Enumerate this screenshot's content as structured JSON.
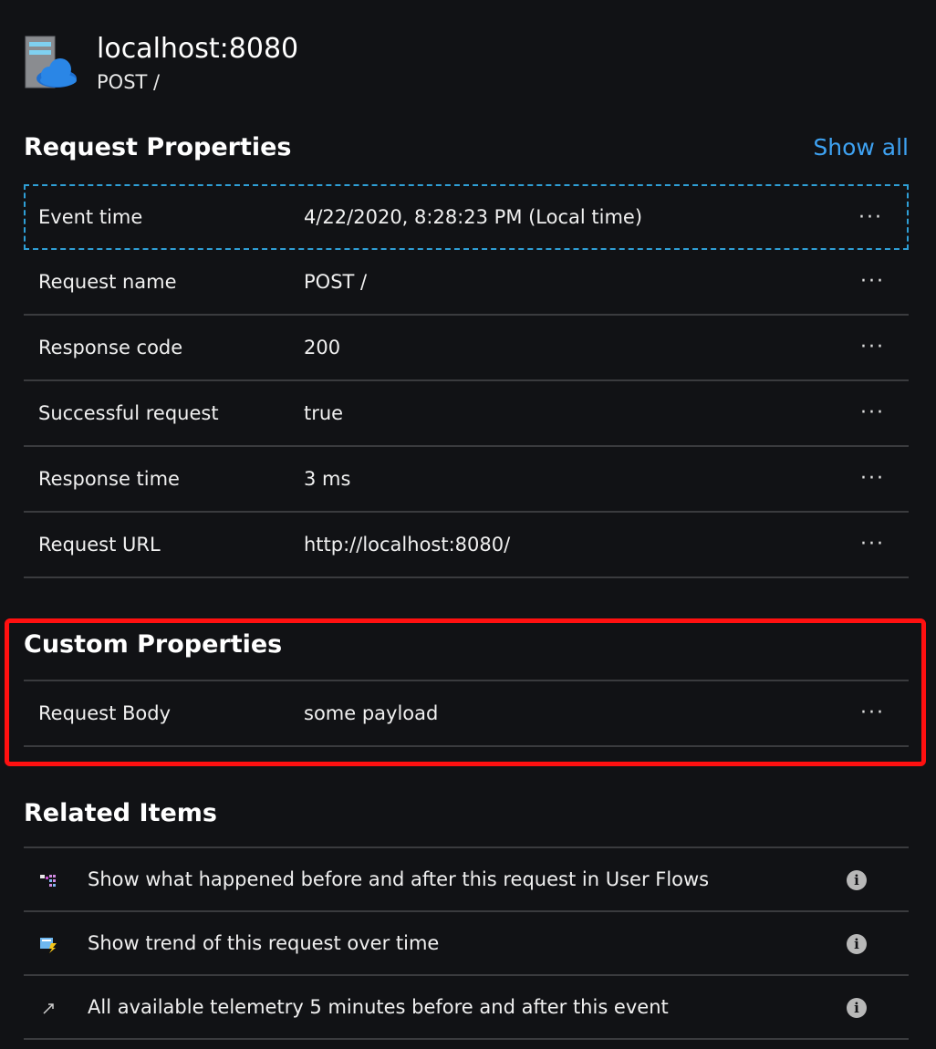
{
  "header": {
    "title": "localhost:8080",
    "subtitle": "POST /"
  },
  "request_properties": {
    "title": "Request Properties",
    "show_all_label": "Show all",
    "rows": [
      {
        "name": "Event time",
        "value": "4/22/2020, 8:28:23 PM (Local time)",
        "more": "···"
      },
      {
        "name": "Request name",
        "value": "POST /",
        "more": "···"
      },
      {
        "name": "Response code",
        "value": "200",
        "more": "···"
      },
      {
        "name": "Successful request",
        "value": "true",
        "more": "···"
      },
      {
        "name": "Response time",
        "value": "3 ms",
        "more": "···"
      },
      {
        "name": "Request URL",
        "value": "http://localhost:8080/",
        "more": "···"
      }
    ]
  },
  "custom_properties": {
    "title": "Custom Properties",
    "rows": [
      {
        "name": "Request Body",
        "value": "some payload",
        "more": "···"
      }
    ]
  },
  "related_items": {
    "title": "Related Items",
    "items": [
      {
        "icon": "user-flows-icon",
        "label": "Show what happened before and after this request in User Flows",
        "info": "i"
      },
      {
        "icon": "trend-chart-icon",
        "label": "Show trend of this request over time",
        "info": "i"
      },
      {
        "icon": "arrow-up-right-icon",
        "label": "All available telemetry 5 minutes before and after this event",
        "info": "i"
      }
    ]
  },
  "colors": {
    "background": "#111215",
    "link": "#3ea2f2",
    "highlight": "#ff1010",
    "focus": "#2f9fd6",
    "divider": "#3a3b3e"
  }
}
